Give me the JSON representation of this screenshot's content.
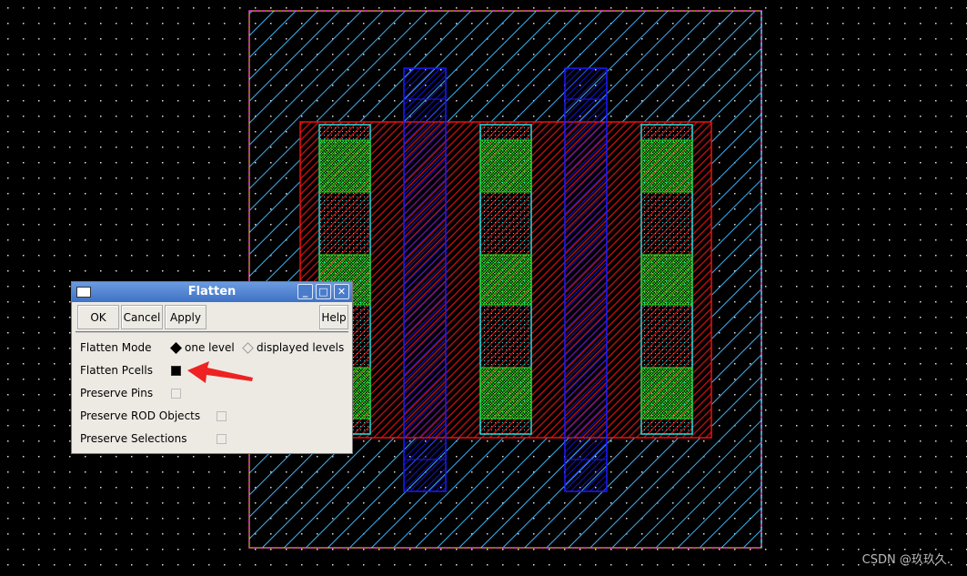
{
  "dialog": {
    "title": "Flatten",
    "buttons": {
      "ok": "OK",
      "cancel": "Cancel",
      "apply": "Apply",
      "help": "Help"
    },
    "flatten_mode": {
      "label": "Flatten Mode",
      "options": [
        "one level",
        "displayed levels"
      ],
      "selected": "one level"
    },
    "flatten_pcells": {
      "label": "Flatten Pcells",
      "checked": true
    },
    "preserve_pins": {
      "label": "Preserve Pins",
      "checked": false
    },
    "preserve_rod": {
      "label": "Preserve ROD Objects",
      "checked": false
    },
    "preserve_selections": {
      "label": "Preserve Selections",
      "checked": false
    }
  },
  "annotation": {
    "arrow_color": "#ee2222",
    "points_to": "Flatten Pcells"
  },
  "layout_colors": {
    "background": "#000000",
    "nwell": "#3fb0f0",
    "poly_red": "#ee1111",
    "gate_blue": "#1a1aff",
    "diff_green": "#22dd22",
    "contact_cyan": "#22dddd"
  },
  "watermark": "CSDN @玖玖久."
}
